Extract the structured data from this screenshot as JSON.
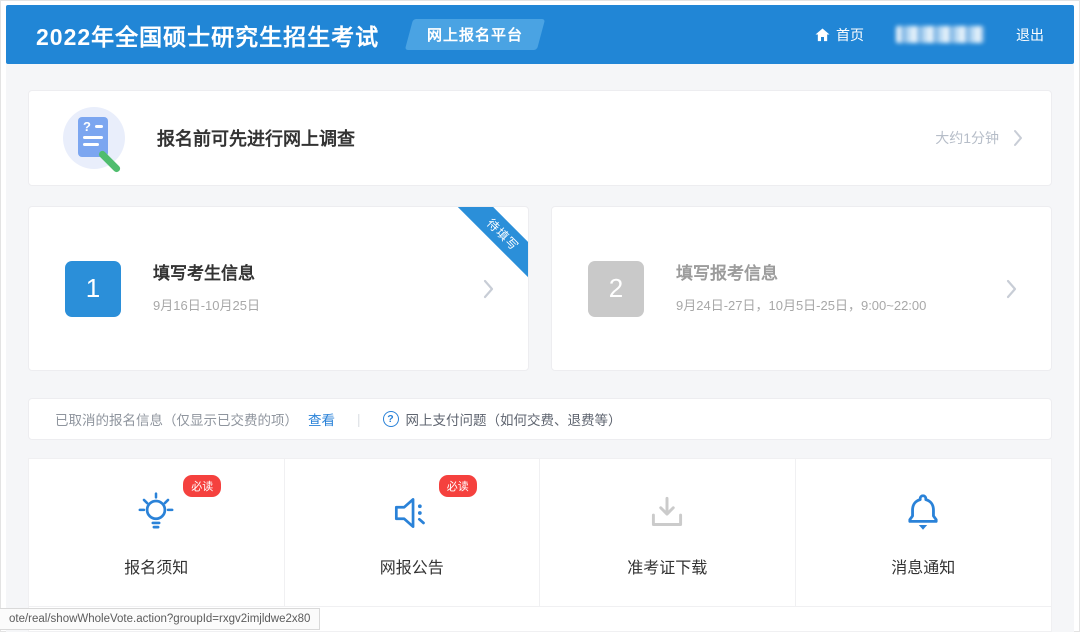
{
  "header": {
    "title": "2022年全国硕士研究生招生考试",
    "badge": "网上报名平台",
    "nav": {
      "home": "首页",
      "logout": "退出"
    }
  },
  "survey": {
    "title": "报名前可先进行网上调查",
    "duration": "大约1分钟",
    "icon": "survey-document-icon"
  },
  "steps": [
    {
      "number": "1",
      "title": "填写考生信息",
      "date": "9月16日-10月25日",
      "ribbon": "待填写",
      "status": "active"
    },
    {
      "number": "2",
      "title": "填写报考信息",
      "date": "9月24日-27日，10月5日-25日，9:00~22:00",
      "status": "inactive"
    }
  ],
  "notice": {
    "cancelled_info": "已取消的报名信息（仅显示已交费的项）",
    "view_link": "查看",
    "divider": "|",
    "question_mark": "?",
    "payment_help": "网上支付问题（如何交费、退费等）"
  },
  "shortcuts": [
    {
      "label": "报名须知",
      "badge": "必读",
      "icon": "lightbulb-icon"
    },
    {
      "label": "网报公告",
      "badge": "必读",
      "icon": "megaphone-icon"
    },
    {
      "label": "准考证下载",
      "icon": "download-icon"
    },
    {
      "label": "消息通知",
      "icon": "bell-icon"
    }
  ],
  "statusbar": {
    "url": "ote/real/showWholeVote.action?groupId=rxgv2imjldwe2x80"
  },
  "colors": {
    "header_blue": "#2186d6",
    "badge_blue": "#4aa3e3",
    "step_blue": "#2b8fd9",
    "link_blue": "#2a82d8",
    "alert_red": "#f5413e",
    "inactive_gray": "#c9c9c9",
    "page_bg": "#f5f6f8"
  }
}
